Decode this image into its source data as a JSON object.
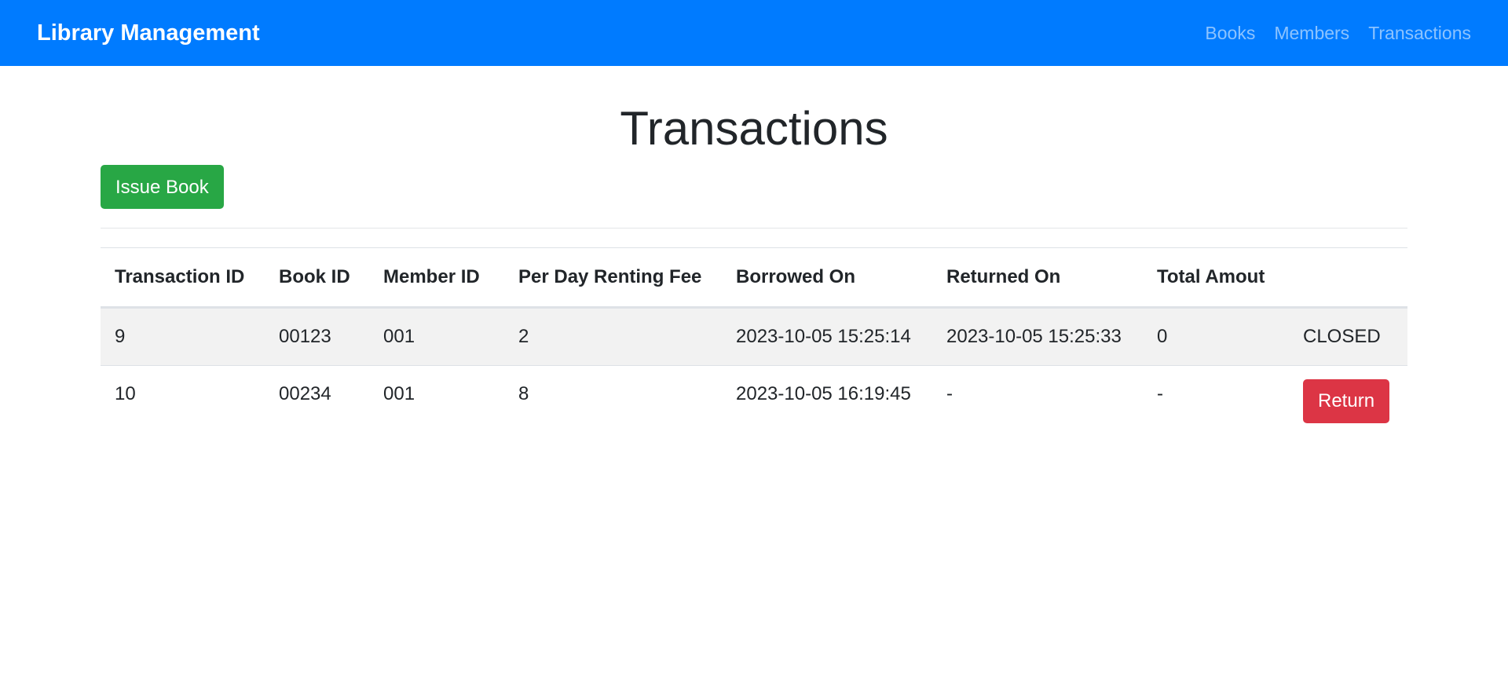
{
  "navbar": {
    "brand": "Library Management",
    "links": [
      "Books",
      "Members",
      "Transactions"
    ]
  },
  "page": {
    "title": "Transactions",
    "issue_button": "Issue Book"
  },
  "table": {
    "headers": [
      "Transaction ID",
      "Book ID",
      "Member ID",
      "Per Day Renting Fee",
      "Borrowed On",
      "Returned On",
      "Total Amout",
      ""
    ],
    "rows": [
      {
        "transaction_id": "9",
        "book_id": "00123",
        "member_id": "001",
        "fee": "2",
        "borrowed_on": "2023-10-05 15:25:14",
        "returned_on": "2023-10-05 15:25:33",
        "total": "0",
        "status": "CLOSED"
      },
      {
        "transaction_id": "10",
        "book_id": "00234",
        "member_id": "001",
        "fee": "8",
        "borrowed_on": "2023-10-05 16:19:45",
        "returned_on": "-",
        "total": "-",
        "action": "Return"
      }
    ]
  },
  "colors": {
    "navbar": "#007bff",
    "issue_button": "#28a745",
    "return_button": "#dc3545"
  }
}
